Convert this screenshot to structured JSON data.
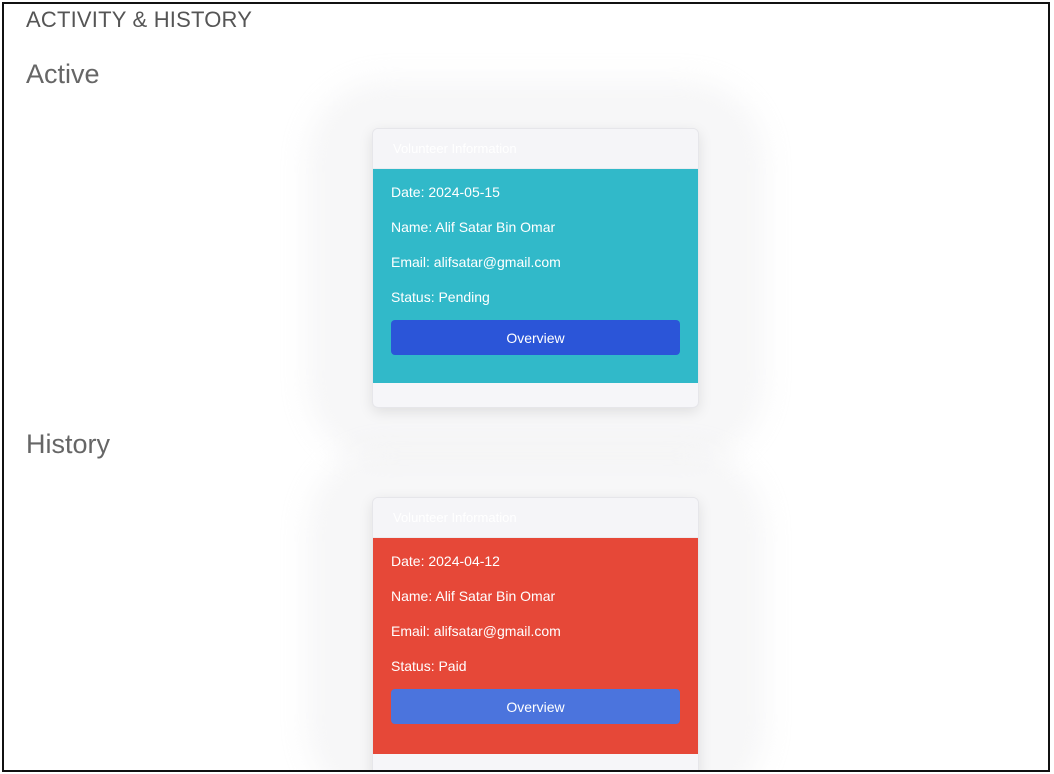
{
  "page": {
    "title": "ACTIVITY & HISTORY"
  },
  "sections": {
    "active": {
      "heading": "Active",
      "card": {
        "header": "Volunteer Information",
        "date": "Date: 2024-05-15",
        "name": "Name: Alif Satar Bin Omar",
        "email": "Email: alifsatar@gmail.com",
        "status": "Status: Pending",
        "button_label": "Overview",
        "color": "#31b9c9"
      }
    },
    "history": {
      "heading": "History",
      "card": {
        "header": "Volunteer Information",
        "date": "Date: 2024-04-12",
        "name": "Name: Alif Satar Bin Omar",
        "email": "Email: alifsatar@gmail.com",
        "status": "Status: Paid",
        "button_label": "Overview",
        "color": "#e64838"
      }
    }
  }
}
